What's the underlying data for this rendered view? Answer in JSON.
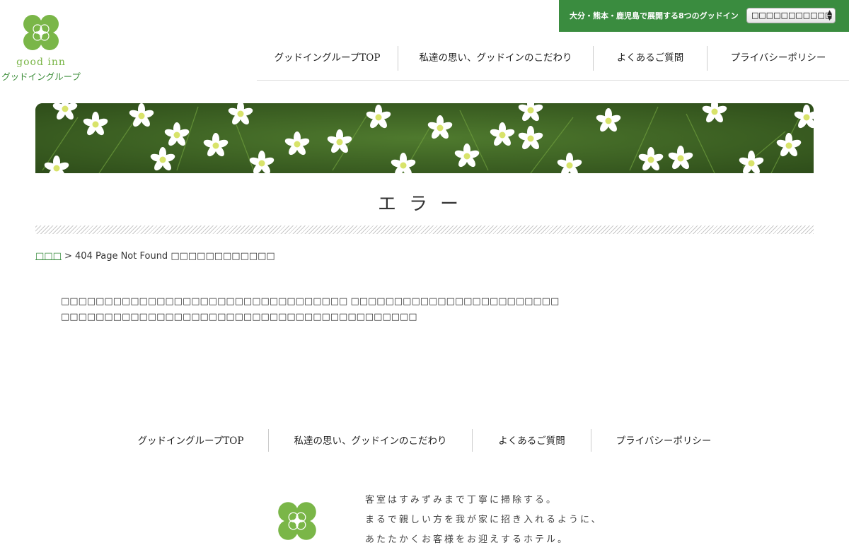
{
  "header": {
    "logo_en": "good inn",
    "logo_jp": "グッドイングループ",
    "topbar_text": "大分・熊本・鹿児島で展開する8つのグッドイン",
    "hotel_select_value": "□□□□□□□□□□□",
    "brand_green": "#7ab648",
    "dark_green": "#3a8c3f"
  },
  "nav": {
    "items": [
      "グッドイングループTOP",
      "私達の思い、グッドインのこだわり",
      "よくあるご質問",
      "プライバシーポリシー"
    ]
  },
  "page": {
    "title": "エラー",
    "breadcrumb_home": "□□□",
    "breadcrumb_sep": " > ",
    "breadcrumb_current": "404 Page Not Found □□□□□□□□□□□□",
    "message_line1": "□□□□□□□□□□□□□□□□□□□□□□□□□□□□□□□□□ □□□□□□□□□□□□□□□□□□□□□□□□",
    "message_line2": "□□□□□□□□□□□□□□□□□□□□□□□□□□□□□□□□□□□□□□□□□"
  },
  "footer": {
    "nav_items": [
      "グッドイングループTOP",
      "私達の思い、グッドインのこだわり",
      "よくあるご質問",
      "プライバシーポリシー"
    ],
    "message_lines": [
      "客室はすみずみまで丁寧に掃除する。",
      "まるで親しい方を我が家に招き入れるように、",
      "あたたかくお客様をお迎えするホテル。"
    ]
  }
}
